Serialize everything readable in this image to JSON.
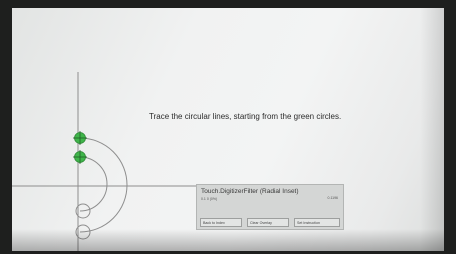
{
  "instruction": "Trace the circular lines, starting from the green circles.",
  "panel": {
    "title": "Touch.DigitizerFilter (Radial Inset)",
    "left_value": "0.1 0 (0%)",
    "right_value": "0.1196",
    "buttons": [
      "Back to Index",
      "Clear Overlay",
      "Set Instruction"
    ]
  },
  "colors": {
    "line": "#8e8e8e",
    "start_marker": "#3fb54a"
  }
}
